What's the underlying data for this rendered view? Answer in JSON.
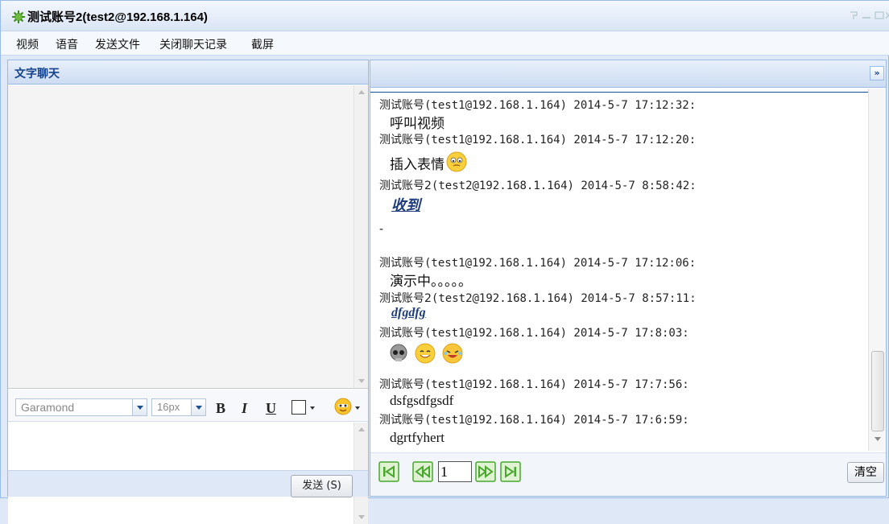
{
  "window": {
    "title": "测试账号2(test2@192.168.1.164)"
  },
  "menu": {
    "items": [
      "视频",
      "语音",
      "发送文件",
      "关闭聊天记录",
      "截屏"
    ]
  },
  "left_panel": {
    "title": "文字聊天",
    "toolbar": {
      "font_family_value": "Garamond",
      "font_size_value": "16px",
      "bold_label": "B",
      "italic_label": "I",
      "underline_label": "U"
    },
    "send_button": "发送 (S)"
  },
  "right_panel": {
    "collapse_label": "»",
    "messages": [
      {
        "sender": "测试账号",
        "meta": "(test1@192.168.1.164) 2014-5-7 17:12:32:",
        "body": "呼叫视频"
      },
      {
        "sender": "测试账号",
        "meta": "(test1@192.168.1.164) 2014-5-7 17:12:20:",
        "body": "插入表情"
      },
      {
        "sender": "测试账号2",
        "meta": "(test2@192.168.1.164) 2014-5-7 8:58:42:",
        "body": "收到"
      },
      {
        "sender": "",
        "meta": "",
        "body": "-"
      },
      {
        "sender": "测试账号",
        "meta": "(test1@192.168.1.164) 2014-5-7 17:12:06:",
        "body": "演示中。。。。。"
      },
      {
        "sender": "测试账号2",
        "meta": "(test2@192.168.1.164) 2014-5-7 8:57:11:",
        "body": "dfgdfg"
      },
      {
        "sender": "测试账号",
        "meta": "(test1@192.168.1.164) 2014-5-7 17:8:03:",
        "body": ""
      },
      {
        "sender": "测试账号",
        "meta": "(test1@192.168.1.164) 2014-5-7 17:7:56:",
        "body": "dsfgsdfgsdf"
      },
      {
        "sender": "测试账号",
        "meta": "(test1@192.168.1.164) 2014-5-7 17:6:59:",
        "body": "dgrtfyhert"
      }
    ],
    "pager": {
      "page": "1",
      "clear_button": "清空"
    }
  },
  "colors": {
    "accent": "#15428b",
    "frame": "#99bbe8",
    "pager_green": "#47a82c"
  },
  "icons": [
    "app-icon",
    "smiley-icon",
    "skull-icon",
    "grin-icon",
    "laugh-icon",
    "first-page-icon",
    "prev-page-icon",
    "next-page-icon",
    "last-page-icon"
  ]
}
